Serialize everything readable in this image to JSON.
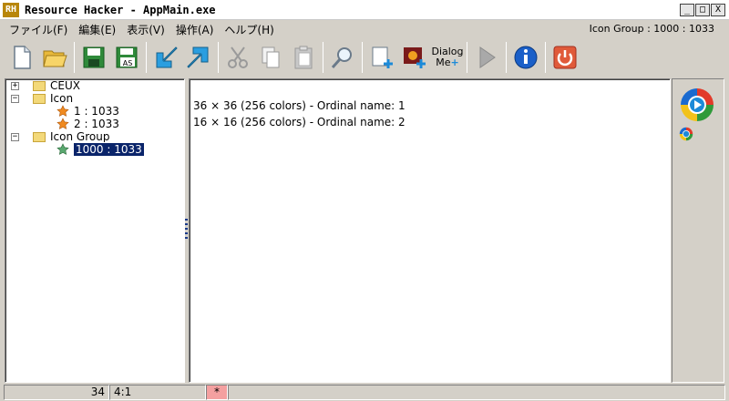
{
  "window": {
    "title": "Resource Hacker  -  AppMain.exe",
    "logo": "RH",
    "min": "_",
    "max": "□",
    "close": "X"
  },
  "menu": {
    "items": [
      "ファイル(F)",
      "編集(E)",
      "表示(V)",
      "操作(A)",
      "ヘルプ(H)"
    ],
    "status_right": "Icon Group : 1000 : 1033"
  },
  "toolbar": {
    "buttons": [
      "new-file",
      "open-folder",
      "save",
      "save-as",
      "import",
      "export",
      "cut",
      "copy",
      "paste",
      "find",
      "add-resource",
      "add-image",
      "dialog-menu",
      "run-script",
      "info",
      "exit"
    ],
    "save_as_label": "AS",
    "dialog_label_1": "Dialog",
    "dialog_label_2": "Me"
  },
  "tree": {
    "nodes": [
      {
        "label": "CEUX",
        "expander": "+"
      },
      {
        "label": "Icon",
        "expander": "-"
      },
      {
        "label": "1 : 1033"
      },
      {
        "label": "2 : 1033"
      },
      {
        "label": "Icon Group",
        "expander": "-"
      },
      {
        "label": "1000 : 1033",
        "selected": true
      }
    ]
  },
  "content": {
    "lines": [
      "36 × 36 (256 colors) - Ordinal name: 1",
      "16 × 16 (256 colors) - Ordinal name: 2"
    ]
  },
  "statusbar": {
    "line": "34",
    "position": "4:1",
    "modified": "*"
  },
  "colors": {
    "selection": "#0a246a",
    "accent": "#1c8ad8",
    "modified": "#f4a0a0"
  }
}
